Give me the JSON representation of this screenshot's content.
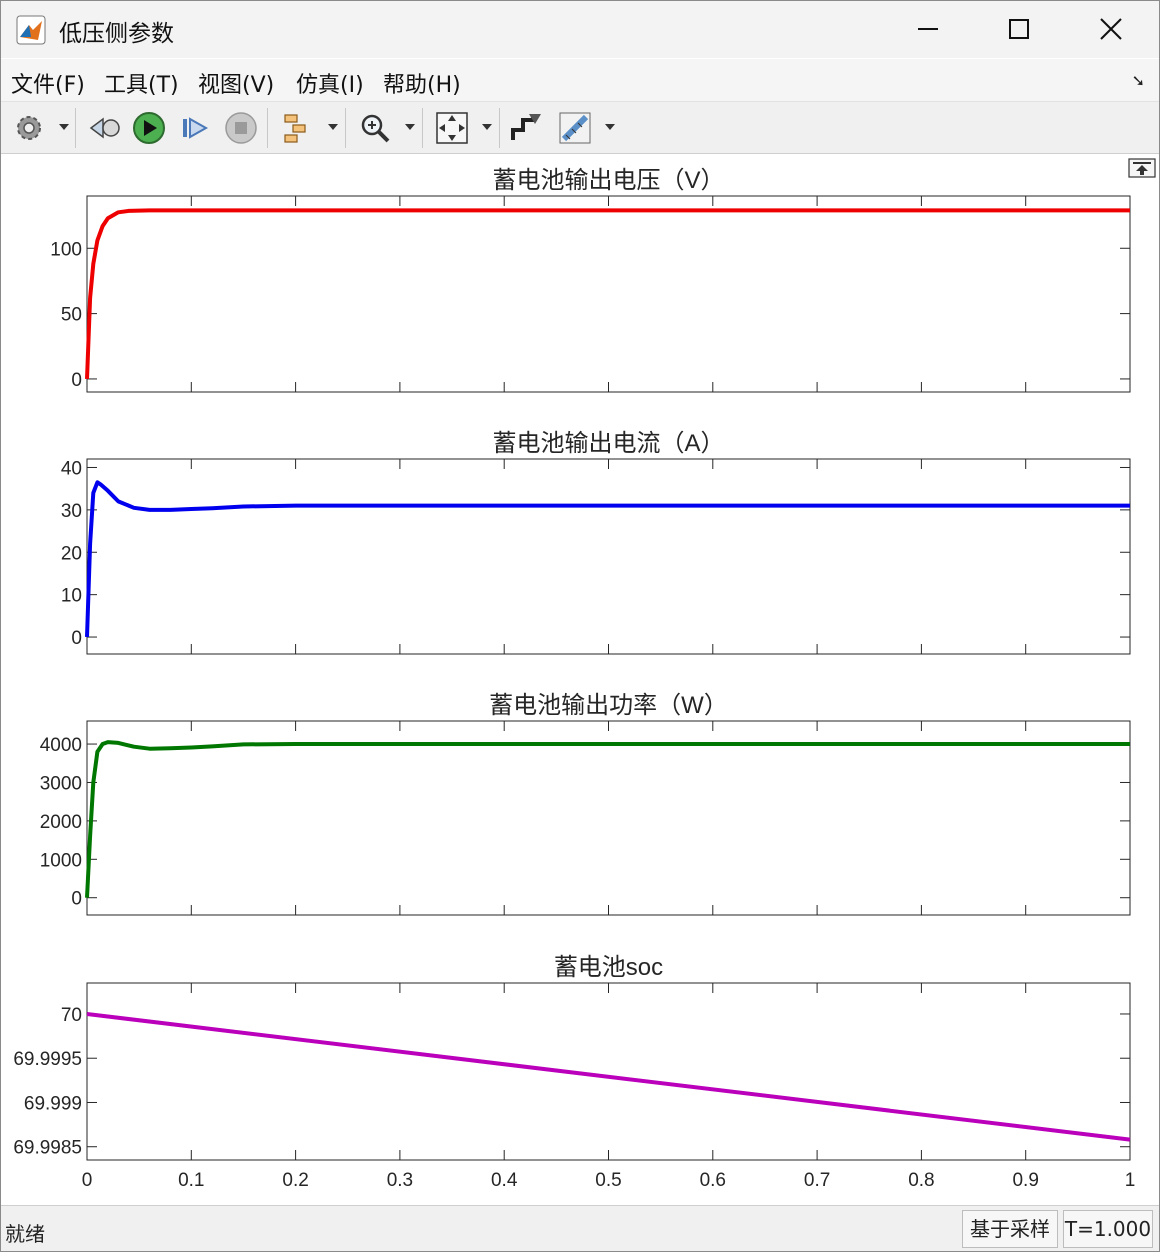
{
  "window": {
    "title": "低压侧参数"
  },
  "menu": [
    "文件(F)",
    "工具(T)",
    "视图(V)",
    "仿真(I)",
    "帮助(H)"
  ],
  "toolbar": {
    "icons": [
      "gear-icon",
      "rewind-icon",
      "run-icon",
      "step-forward-icon",
      "stop-icon",
      "signal-select-icon",
      "zoom-icon",
      "fit-to-view-icon",
      "style-icon",
      "measure-icon"
    ]
  },
  "status": {
    "left": "就绪",
    "sample": "基于采样",
    "time": "T=1.000"
  },
  "chart_data": [
    {
      "type": "line",
      "title": "蓄电池输出电压（V）",
      "ylim": [
        -10,
        140
      ],
      "yticks": [
        0,
        50,
        100
      ],
      "ytick_labels": [
        "0",
        "50",
        "100"
      ],
      "xlim": [
        0,
        1
      ],
      "color": "#ee0000",
      "series": [
        {
          "x": [
            0,
            0.003,
            0.006,
            0.01,
            0.015,
            0.02,
            0.03,
            0.04,
            0.06,
            0.1,
            0.3,
            0.6,
            1.0
          ],
          "y": [
            0,
            62,
            88,
            106,
            117,
            123,
            127.5,
            128.6,
            129,
            129,
            129,
            129,
            129
          ]
        }
      ]
    },
    {
      "type": "line",
      "title": "蓄电池输出电流（A）",
      "ylim": [
        -4,
        42
      ],
      "yticks": [
        0,
        10,
        20,
        30,
        40
      ],
      "ytick_labels": [
        "0",
        "10",
        "20",
        "30",
        "40"
      ],
      "xlim": [
        0,
        1
      ],
      "color": "#0000ee",
      "series": [
        {
          "x": [
            0,
            0.003,
            0.006,
            0.01,
            0.013,
            0.02,
            0.03,
            0.045,
            0.06,
            0.08,
            0.1,
            0.12,
            0.15,
            0.2,
            0.5,
            1.0
          ],
          "y": [
            0,
            22,
            34,
            36.5,
            36,
            34.5,
            32,
            30.5,
            30,
            30,
            30.2,
            30.4,
            30.8,
            31,
            31,
            31
          ]
        }
      ]
    },
    {
      "type": "line",
      "title": "蓄电池输出功率（W）",
      "ylim": [
        -450,
        4600
      ],
      "yticks": [
        0,
        1000,
        2000,
        3000,
        4000
      ],
      "ytick_labels": [
        "0",
        "1000",
        "2000",
        "3000",
        "4000"
      ],
      "xlim": [
        0,
        1
      ],
      "color": "#007700",
      "series": [
        {
          "x": [
            0,
            0.003,
            0.006,
            0.01,
            0.015,
            0.02,
            0.03,
            0.045,
            0.06,
            0.08,
            0.1,
            0.12,
            0.15,
            0.2,
            0.5,
            1.0
          ],
          "y": [
            0,
            1600,
            3000,
            3800,
            4000,
            4050,
            4030,
            3930,
            3880,
            3890,
            3910,
            3940,
            3990,
            4000,
            4000,
            4000
          ]
        }
      ]
    },
    {
      "type": "line",
      "title": "蓄电池soc",
      "ylim": [
        69.99835,
        70.00035
      ],
      "yticks": [
        69.9985,
        69.999,
        69.9995,
        70
      ],
      "ytick_labels": [
        "69.9985",
        "69.999",
        "69.9995",
        "70"
      ],
      "xlim": [
        0,
        1
      ],
      "xticks": [
        0,
        0.1,
        0.2,
        0.3,
        0.4,
        0.5,
        0.6,
        0.7,
        0.8,
        0.9,
        1
      ],
      "xtick_labels": [
        "0",
        "0.1",
        "0.2",
        "0.3",
        "0.4",
        "0.5",
        "0.6",
        "0.7",
        "0.8",
        "0.9",
        "1"
      ],
      "color": "#bb00bb",
      "series": [
        {
          "x": [
            0,
            1
          ],
          "y": [
            70,
            69.99858
          ]
        }
      ]
    }
  ]
}
